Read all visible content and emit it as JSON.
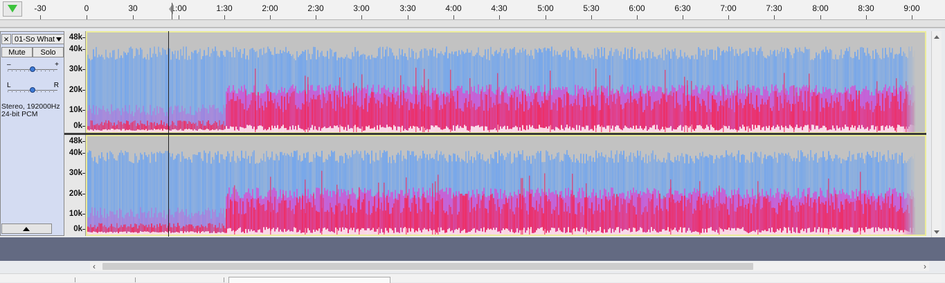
{
  "ruler": {
    "labels": [
      "-30",
      "0",
      "30",
      "1:00",
      "1:30",
      "2:00",
      "2:30",
      "3:00",
      "3:30",
      "4:00",
      "4:30",
      "5:00",
      "5:30",
      "6:00",
      "6:30",
      "7:00",
      "7:30",
      "8:00",
      "8:30",
      "9:00"
    ]
  },
  "track": {
    "close_label": "×",
    "name": "01-So What",
    "mute_label": "Mute",
    "solo_label": "Solo",
    "gain_minus": "–",
    "gain_plus": "+",
    "gain_level": 0.5,
    "pan_left": "L",
    "pan_right": "R",
    "pan_level": 0.5,
    "info_line1": "Stereo, 192000Hz",
    "info_line2": "24-bit PCM"
  },
  "freq_scale": {
    "labels": [
      "48k",
      "40k",
      "30k",
      "20k",
      "10k",
      "0k"
    ]
  },
  "colors": {
    "background": "#c2c2c2",
    "low_energy": "#6fa4ee",
    "mid_energy": "#d84bd3",
    "high_energy": "#f02a5c",
    "peak": "#ffffff",
    "selection_border": "#ecec9a",
    "empty_area": "#636a82"
  }
}
